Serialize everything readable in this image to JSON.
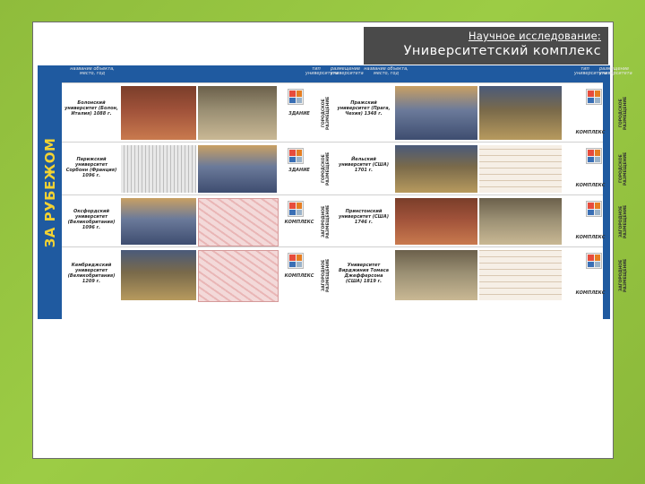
{
  "header": {
    "subtitle": "Научное исследование:",
    "title": "Университетский комплекс"
  },
  "poster": {
    "side_label": "ЗА РУБЕЖОМ",
    "col_headers": {
      "object": "название объекта, место, год",
      "type": "тип университета",
      "placement": "размещение университета"
    },
    "left_rows": [
      {
        "caption": "Болонский университет (Болон, Италия) 1088 г.",
        "type": "ЗДАНИЕ",
        "placement": "ГОРОДСКОЕ РАЗМЕЩЕНИЕ"
      },
      {
        "caption": "Парижский университет Сорбонн (Франция) 1096 г.",
        "type": "ЗДАНИЕ",
        "placement": "ГОРОДСКОЕ РАЗМЕЩЕНИЕ"
      },
      {
        "caption": "Оксфордский университет (Великобритания) 1096 г.",
        "type": "КОМПЛЕКС",
        "placement": "ЗАГОРОДНОЕ РАЗМЕЩЕНИЕ"
      },
      {
        "caption": "Кембриджский университет (Великобритания) 1209 г.",
        "type": "КОМПЛЕКС",
        "placement": "ЗАГОРОДНОЕ РАЗМЕЩЕНИЕ"
      }
    ],
    "right_rows": [
      {
        "caption": "Пражский университет (Прага, Чехия) 1348 г.",
        "type": "КОМПЛЕКС",
        "placement": "ГОРОДСКОЕ РАЗМЕЩЕНИЕ"
      },
      {
        "caption": "Йельский университет (США) 1701 г.",
        "type": "КОМПЛЕКС",
        "placement": "ГОРОДСКОЕ РАЗМЕЩЕНИЕ"
      },
      {
        "caption": "Принстонский университет (США) 1746 г.",
        "type": "КОМПЛЕКС",
        "placement": "ЗАГОРОДНОЕ РАЗМЕЩЕНИЕ"
      },
      {
        "caption": "Университет Вирджиния Томаса Джефферсона (США) 1819 г.",
        "type": "КОМПЛЕКС",
        "placement": "ЗАГОРОДНОЕ РАЗМЕЩЕНИЕ"
      }
    ]
  },
  "colors": {
    "background": "#8fbc3c",
    "poster_blue": "#1f5aa0",
    "side_text": "#f2d233"
  }
}
